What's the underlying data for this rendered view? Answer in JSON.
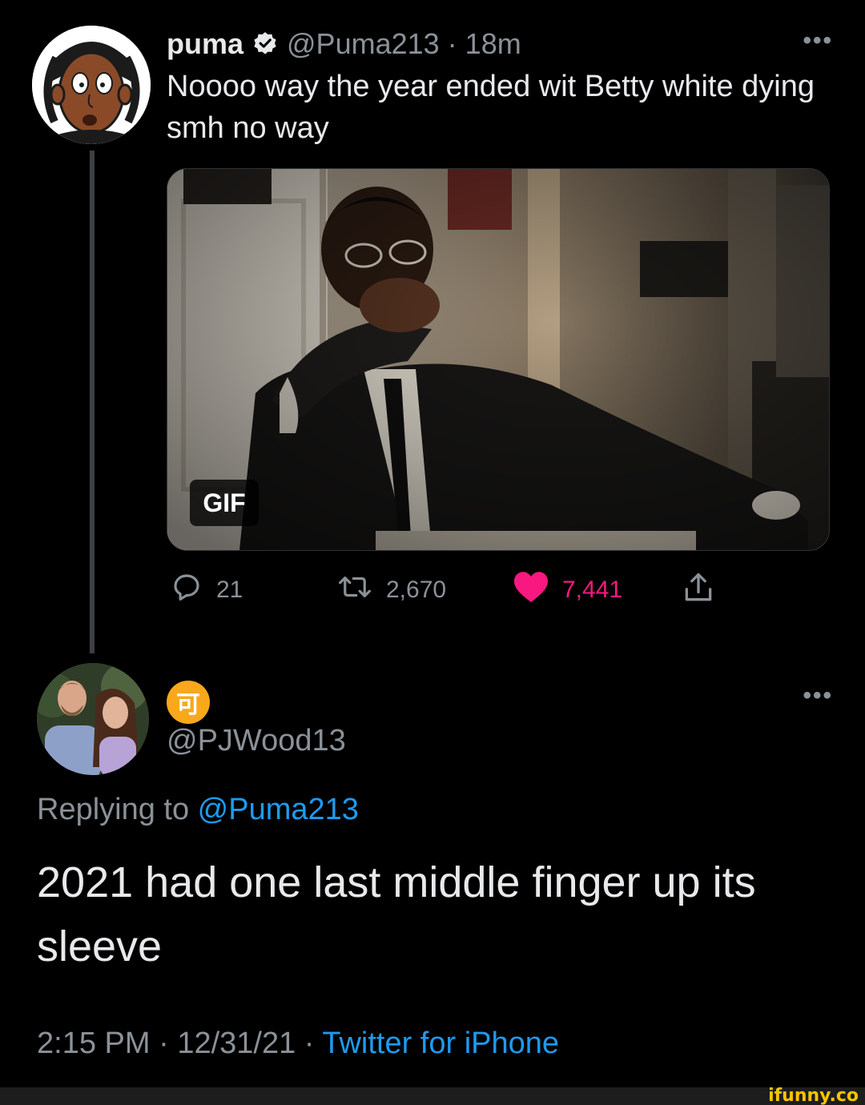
{
  "tweet": {
    "author_name": "puma",
    "handle": "@Puma213",
    "separator": "·",
    "time": "18m",
    "text": "Noooo way the year ended wit Betty white dying smh no way",
    "more": "•••",
    "media": {
      "badge": "GIF"
    },
    "actions": {
      "replies": "21",
      "retweets": "2,670",
      "likes": "7,441"
    },
    "colors": {
      "like": "#f91880",
      "verified": "#e7e9ea"
    },
    "icons": [
      "verified-icon",
      "reply-icon",
      "retweet-icon",
      "heart-icon",
      "share-icon"
    ]
  },
  "reply": {
    "badge_glyph": "可",
    "handle": "@PJWood13",
    "more": "•••",
    "replying_prefix": "Replying to ",
    "replying_handle": "@Puma213",
    "text": "2021 had one last middle finger up its sleeve",
    "timestamp": "2:15 PM",
    "separator": "·",
    "date": "12/31/21",
    "separator2": "·",
    "source": "Twitter for iPhone",
    "colors": {
      "link": "#1d9bf0",
      "badge": "#f8a81a"
    }
  },
  "watermark": "ifunny.co"
}
